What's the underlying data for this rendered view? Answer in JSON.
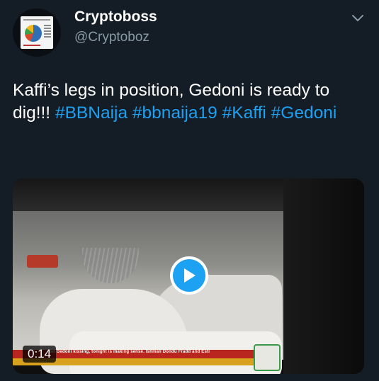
{
  "author": {
    "name": "Cryptoboss",
    "handle": "@Cryptoboz"
  },
  "tweet": {
    "text_plain": "Kaffi’s legs in position, Gedoni is ready to dig!!! ",
    "hashtags": [
      "#BBNaija",
      "#bbnaija19",
      "#Kaffi",
      "#Gedoni"
    ]
  },
  "media": {
    "duration": "0:14",
    "ticker_text": "nd Gedoni kissing, tonight is making sense. Ishmali Dondu Fradd and Esti"
  },
  "colors": {
    "background": "#141d26",
    "link": "#1da1f2",
    "secondary_text": "#8899a6"
  },
  "icons": {
    "menu": "chevron-down-icon",
    "play": "play-icon"
  }
}
